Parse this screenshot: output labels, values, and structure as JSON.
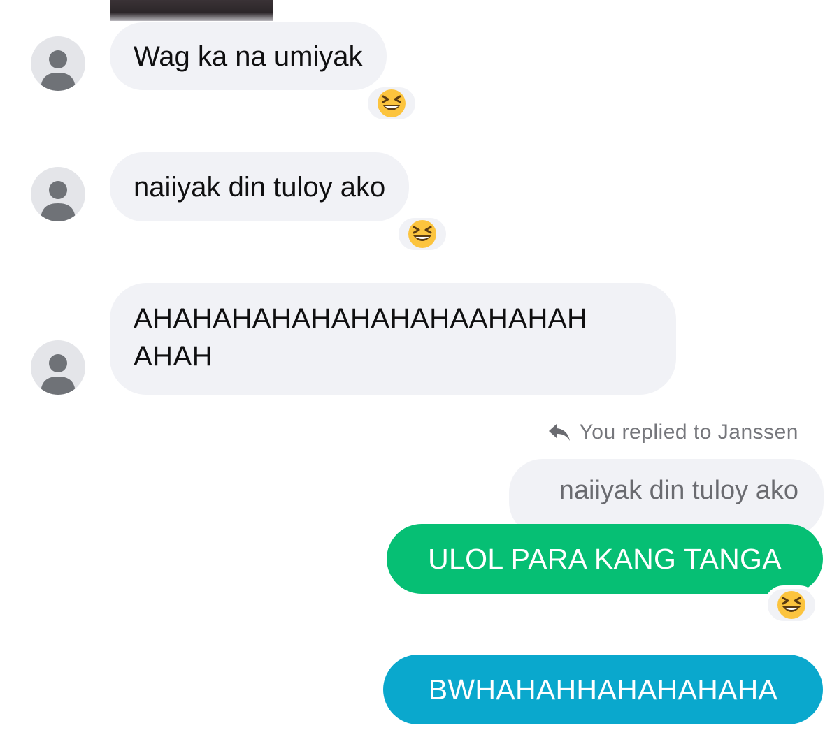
{
  "messages": {
    "m1": {
      "text": "Wag ka na umiyak",
      "reaction": "laughing-squint-emoji"
    },
    "m2": {
      "text": "naiiyak din tuloy ako",
      "reaction": "laughing-squint-emoji"
    },
    "m3": {
      "line1": "AHAHAHAHAHAHAHAHAAHAHAH",
      "line2": "AHAH"
    },
    "reply_context": {
      "label": "You replied to Janssen",
      "quoted_text": "naiiyak din tuloy ako"
    },
    "m4": {
      "text": "ULOL PARA KANG TANGA",
      "reaction": "laughing-squint-emoji",
      "color": "#06bf74"
    },
    "m5": {
      "text": "BWHAHAHHAHAHAHAHA",
      "color": "#0aa8cd"
    }
  },
  "colors": {
    "incoming_bubble": "#f1f2f6",
    "avatar_bg": "#e4e5e9",
    "avatar_fg": "#6f7277",
    "emoji_face": "#fcc43e"
  }
}
